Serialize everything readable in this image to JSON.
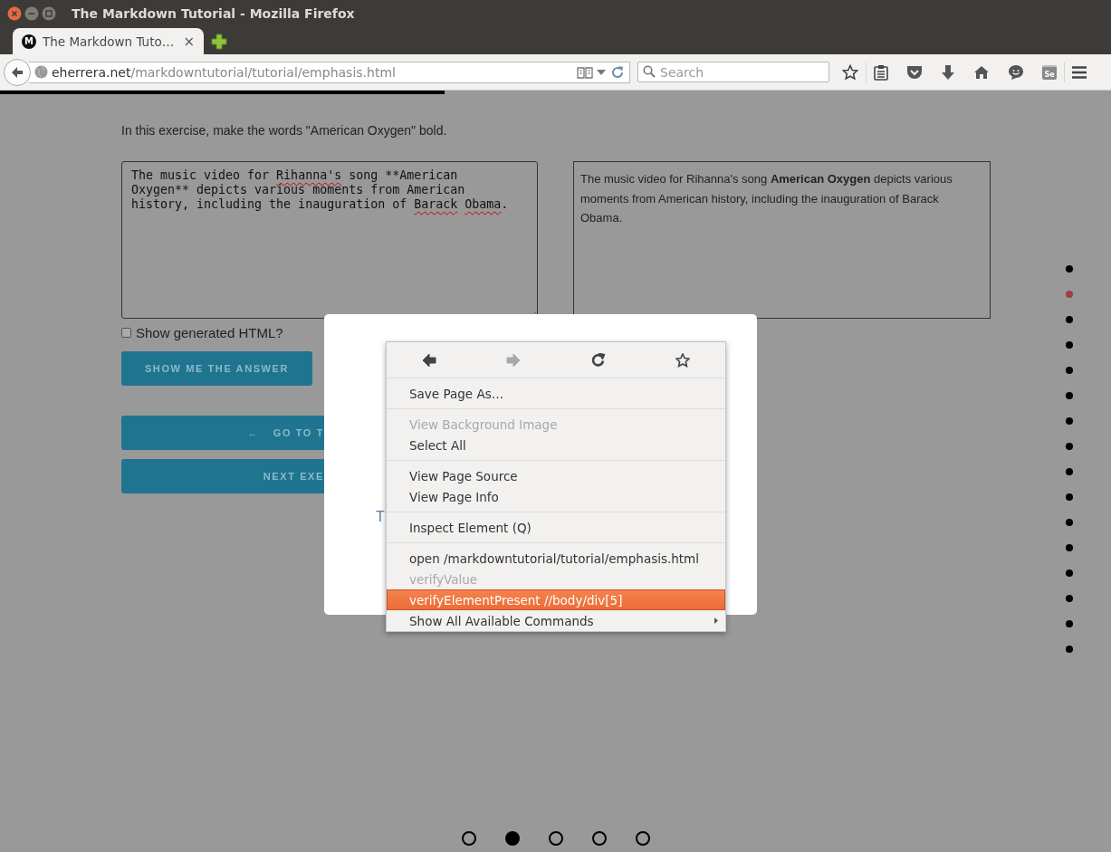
{
  "window": {
    "title": "The Markdown Tutorial - Mozilla Firefox"
  },
  "tabs": [
    {
      "favicon": "M",
      "label": "The Markdown Tuto…",
      "close": "×",
      "selected": true
    }
  ],
  "address_bar": {
    "host": "eherrera.net",
    "path": "/markdowntutorial/tutorial/emphasis.html"
  },
  "search": {
    "placeholder": "Search"
  },
  "toolbar_badge": "Se",
  "reading_progress": {
    "level": 0.4
  },
  "exercise": {
    "instruction": "In this exercise, make the words \"American Oxygen\" bold.",
    "editor": [
      {
        "text": "The music video for ",
        "misspelled": false
      },
      {
        "text": "Rihanna's",
        "misspelled": true
      },
      {
        "text": " song **American Oxygen** depicts various moments from American history, including the inauguration of ",
        "misspelled": false
      },
      {
        "text": "Barack Obama",
        "misspelled": true
      },
      {
        "text": ".",
        "misspelled": false
      }
    ],
    "preview": "The music video for Rihanna's song **American Oxygen** depicts various moments from American history, including the inauguration of Barack Obama.",
    "show_html": {
      "label": "Show generated HTML?",
      "checked": false
    },
    "answer_button": "SHOW ME THE ANSWER",
    "prev_button": {
      "arrow": "←",
      "label": "GO TO T"
    },
    "next_button": "NEXT EXE"
  },
  "modal": {
    "text": "T"
  },
  "context_menu": {
    "nav": [
      {
        "kind": "back",
        "disabled": false
      },
      {
        "kind": "forward",
        "disabled": true
      },
      {
        "kind": "reload",
        "disabled": false
      },
      {
        "kind": "bookmark",
        "disabled": false
      }
    ],
    "groups": [
      [
        {
          "label": "Save Page As…",
          "disabled": false,
          "selected": false,
          "submenu": false
        }
      ],
      [
        {
          "label": "View Background Image",
          "disabled": true,
          "selected": false,
          "submenu": false
        },
        {
          "label": "Select All",
          "disabled": false,
          "selected": false,
          "submenu": false
        }
      ],
      [
        {
          "label": "View Page Source",
          "disabled": false,
          "selected": false,
          "submenu": false
        },
        {
          "label": "View Page Info",
          "disabled": false,
          "selected": false,
          "submenu": false
        }
      ],
      [
        {
          "label": "Inspect Element (Q)",
          "disabled": false,
          "selected": false,
          "submenu": false
        }
      ],
      [
        {
          "label": "open /markdowntutorial/tutorial/emphasis.html",
          "disabled": false,
          "selected": false,
          "submenu": false
        },
        {
          "label": "verifyValue",
          "disabled": true,
          "selected": false,
          "submenu": false
        },
        {
          "label": "verifyElementPresent //body/div[5]",
          "disabled": false,
          "selected": true,
          "submenu": false
        },
        {
          "label": "Show All Available Commands",
          "disabled": false,
          "selected": false,
          "submenu": true
        }
      ]
    ]
  },
  "side_dots": [
    {
      "selected": false
    },
    {
      "selected": true
    },
    {
      "selected": false
    },
    {
      "selected": false
    },
    {
      "selected": false
    },
    {
      "selected": false
    },
    {
      "selected": false
    },
    {
      "selected": false
    },
    {
      "selected": false
    },
    {
      "selected": false
    },
    {
      "selected": false
    },
    {
      "selected": false
    },
    {
      "selected": false
    },
    {
      "selected": false
    },
    {
      "selected": false
    },
    {
      "selected": false
    }
  ],
  "page_dots": [
    {
      "selected": false
    },
    {
      "selected": true
    },
    {
      "selected": false
    },
    {
      "selected": false
    },
    {
      "selected": false
    }
  ]
}
